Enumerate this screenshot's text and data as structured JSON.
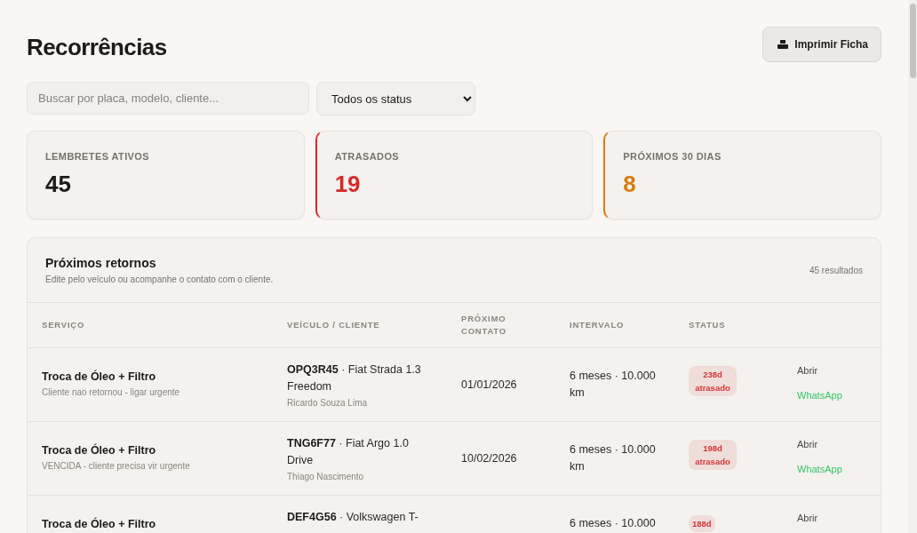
{
  "title": "Recorrências",
  "print_button": {
    "label": "Imprimir Ficha"
  },
  "search": {
    "placeholder": "Buscar por placa, modelo, cliente..."
  },
  "status_filter": {
    "value": "Todos os status"
  },
  "stats": [
    {
      "label": "LEMBRETES ATIVOS",
      "value": "45",
      "kind": "neutral"
    },
    {
      "label": "ATRASADOS",
      "value": "19",
      "kind": "late"
    },
    {
      "label": "PRÓXIMOS 30 DIAS",
      "value": "8",
      "kind": "soon"
    }
  ],
  "table": {
    "title": "Próximos retornos",
    "subtitle": "Edite pelo veículo ou acompanhe o contato com o cliente.",
    "count": "45 resultados",
    "columns": [
      "SERVIÇO",
      "VEÍCULO / CLIENTE",
      "PRÓXIMO CONTATO",
      "INTERVALO",
      "STATUS"
    ],
    "rows": [
      {
        "service": "Troca de Óleo + Filtro",
        "note": "Cliente nao retornou - ligar urgente",
        "vehicle": "**OPQ3R45** · Fiat Strada 1.3 Freedom",
        "client": "Ricardo Souza Lima",
        "date": "01/01/2026",
        "interval": "6 meses · 10.000 km",
        "status": "238d atrasado",
        "color": "#d4363a",
        "actions": [
          "Abrir",
          "WhatsApp"
        ]
      },
      {
        "service": "Troca de Óleo + Filtro",
        "note": "VENCIDA - cliente precisa vir urgente",
        "vehicle": "**TNG6F77** · Fiat Argo 1.0 Drive",
        "client": "Thiago Nascimento",
        "date": "10/02/2026",
        "interval": "6 meses · 10.000 km",
        "status": "198d atrasado",
        "color": "#d4363a",
        "actions": [
          "Abrir",
          "WhatsApp"
        ]
      },
      {
        "service": "Troca de Óleo + Filtro",
        "vehicle": "**DEF4G56** · Volkswagen T-",
        "interval": "6 meses · 10.000",
        "status": "188d",
        "color": "#d4363a",
        "actions": [
          "Abrir"
        ]
      }
    ]
  }
}
